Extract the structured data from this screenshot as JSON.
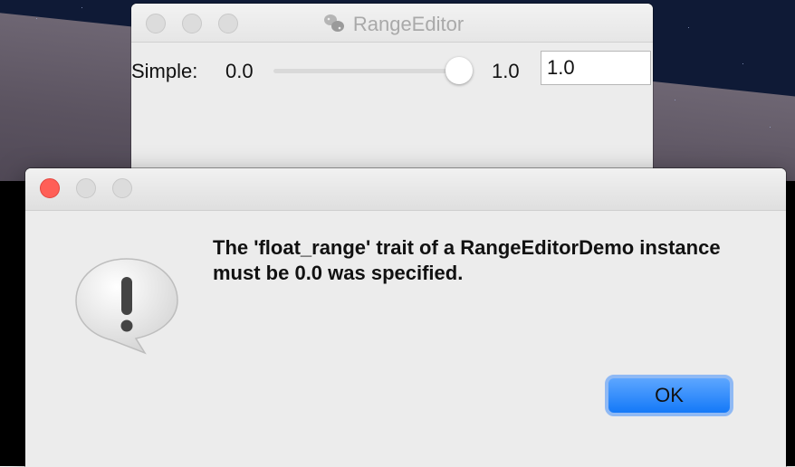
{
  "background_window": {
    "title": "RangeEditor",
    "title_icon": "python-app-icon",
    "simple_label": "Simple:",
    "range_low": "0.0",
    "range_high": "1.0",
    "slider_value": 1.0,
    "input_value": "1.0"
  },
  "alert": {
    "icon": "caution-speech-bubble-icon",
    "message": "The 'float_range' trait of a RangeEditorDemo instance must be 0.0 was specified.",
    "ok_label": "OK"
  },
  "colors": {
    "close": "#ff5f57",
    "ok_button": "#1479f8",
    "focus_ring": "#8fb9f4"
  }
}
